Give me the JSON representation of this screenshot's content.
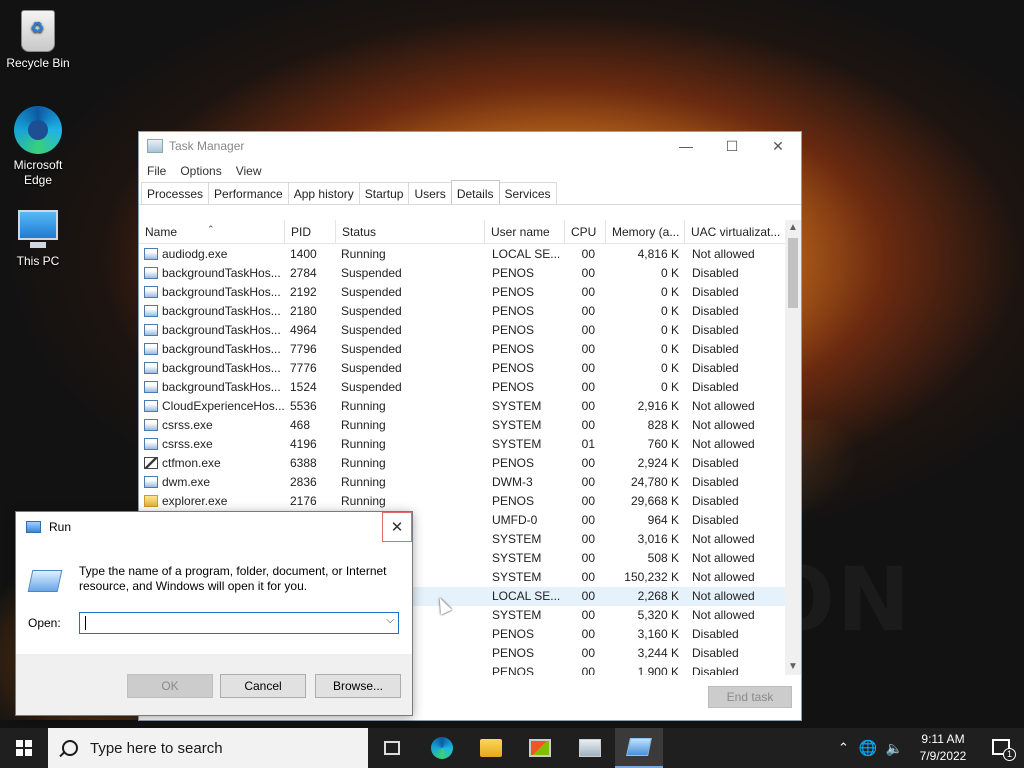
{
  "desktop": {
    "icons": [
      {
        "label": "Recycle Bin"
      },
      {
        "label": "Microsoft Edge"
      },
      {
        "label": "This PC"
      }
    ],
    "wallpaper_text": "ON"
  },
  "task_manager": {
    "title": "Task Manager",
    "menu": [
      "File",
      "Options",
      "View"
    ],
    "tabs": [
      "Processes",
      "Performance",
      "App history",
      "Startup",
      "Users",
      "Details",
      "Services"
    ],
    "active_tab": "Details",
    "columns": [
      "Name",
      "PID",
      "Status",
      "User name",
      "CPU",
      "Memory (a...",
      "UAC virtualizat..."
    ],
    "rows": [
      {
        "icon": "app-icon",
        "name": "audiodg.exe",
        "pid": "1400",
        "status": "Running",
        "user": "LOCAL SE...",
        "cpu": "00",
        "mem": "4,816 K",
        "uac": "Not allowed"
      },
      {
        "icon": "app-icon",
        "name": "backgroundTaskHos...",
        "pid": "2784",
        "status": "Suspended",
        "user": "PENOS",
        "cpu": "00",
        "mem": "0 K",
        "uac": "Disabled"
      },
      {
        "icon": "app-icon",
        "name": "backgroundTaskHos...",
        "pid": "2192",
        "status": "Suspended",
        "user": "PENOS",
        "cpu": "00",
        "mem": "0 K",
        "uac": "Disabled"
      },
      {
        "icon": "app-icon",
        "name": "backgroundTaskHos...",
        "pid": "2180",
        "status": "Suspended",
        "user": "PENOS",
        "cpu": "00",
        "mem": "0 K",
        "uac": "Disabled"
      },
      {
        "icon": "app-icon",
        "name": "backgroundTaskHos...",
        "pid": "4964",
        "status": "Suspended",
        "user": "PENOS",
        "cpu": "00",
        "mem": "0 K",
        "uac": "Disabled"
      },
      {
        "icon": "app-icon",
        "name": "backgroundTaskHos...",
        "pid": "7796",
        "status": "Suspended",
        "user": "PENOS",
        "cpu": "00",
        "mem": "0 K",
        "uac": "Disabled"
      },
      {
        "icon": "app-icon",
        "name": "backgroundTaskHos...",
        "pid": "7776",
        "status": "Suspended",
        "user": "PENOS",
        "cpu": "00",
        "mem": "0 K",
        "uac": "Disabled"
      },
      {
        "icon": "app-icon",
        "name": "backgroundTaskHos...",
        "pid": "1524",
        "status": "Suspended",
        "user": "PENOS",
        "cpu": "00",
        "mem": "0 K",
        "uac": "Disabled"
      },
      {
        "icon": "app-icon",
        "name": "CloudExperienceHos...",
        "pid": "5536",
        "status": "Running",
        "user": "SYSTEM",
        "cpu": "00",
        "mem": "2,916 K",
        "uac": "Not allowed"
      },
      {
        "icon": "app-icon",
        "name": "csrss.exe",
        "pid": "468",
        "status": "Running",
        "user": "SYSTEM",
        "cpu": "00",
        "mem": "828 K",
        "uac": "Not allowed"
      },
      {
        "icon": "app-icon",
        "name": "csrss.exe",
        "pid": "4196",
        "status": "Running",
        "user": "SYSTEM",
        "cpu": "01",
        "mem": "760 K",
        "uac": "Not allowed"
      },
      {
        "icon": "pen-icon",
        "name": "ctfmon.exe",
        "pid": "6388",
        "status": "Running",
        "user": "PENOS",
        "cpu": "00",
        "mem": "2,924 K",
        "uac": "Disabled"
      },
      {
        "icon": "app-icon",
        "name": "dwm.exe",
        "pid": "2836",
        "status": "Running",
        "user": "DWM-3",
        "cpu": "00",
        "mem": "24,780 K",
        "uac": "Disabled"
      },
      {
        "icon": "folder-icon",
        "name": "explorer.exe",
        "pid": "2176",
        "status": "Running",
        "user": "PENOS",
        "cpu": "00",
        "mem": "29,668 K",
        "uac": "Disabled"
      },
      {
        "icon": "",
        "name": "",
        "pid": "",
        "status": "",
        "user": "UMFD-0",
        "cpu": "00",
        "mem": "964 K",
        "uac": "Disabled"
      },
      {
        "icon": "",
        "name": "",
        "pid": "",
        "status": "",
        "user": "SYSTEM",
        "cpu": "00",
        "mem": "3,016 K",
        "uac": "Not allowed"
      },
      {
        "icon": "",
        "name": "",
        "pid": "",
        "status": "",
        "user": "SYSTEM",
        "cpu": "00",
        "mem": "508 K",
        "uac": "Not allowed"
      },
      {
        "icon": "",
        "name": "",
        "pid": "",
        "status": "",
        "user": "SYSTEM",
        "cpu": "00",
        "mem": "150,232 K",
        "uac": "Not allowed"
      },
      {
        "icon": "",
        "name": "",
        "pid": "",
        "status": "",
        "user": "LOCAL SE...",
        "cpu": "00",
        "mem": "2,268 K",
        "uac": "Not allowed",
        "selected": true
      },
      {
        "icon": "",
        "name": "",
        "pid": "",
        "status": "",
        "user": "SYSTEM",
        "cpu": "00",
        "mem": "5,320 K",
        "uac": "Not allowed"
      },
      {
        "icon": "",
        "name": "",
        "pid": "",
        "status": "",
        "user": "PENOS",
        "cpu": "00",
        "mem": "3,160 K",
        "uac": "Disabled"
      },
      {
        "icon": "",
        "name": "",
        "pid": "",
        "status": "",
        "user": "PENOS",
        "cpu": "00",
        "mem": "3,244 K",
        "uac": "Disabled"
      },
      {
        "icon": "",
        "name": "",
        "pid": "",
        "status": "",
        "user": "PENOS",
        "cpu": "00",
        "mem": "1,900 K",
        "uac": "Disabled"
      }
    ],
    "end_task_label": "End task"
  },
  "run_dialog": {
    "title": "Run",
    "message": "Type the name of a program, folder, document, or Internet resource, and Windows will open it for you.",
    "open_label": "Open:",
    "open_value": "",
    "ok_label": "OK",
    "cancel_label": "Cancel",
    "browse_label": "Browse..."
  },
  "taskbar": {
    "search_placeholder": "Type here to search",
    "time": "9:11 AM",
    "date": "7/9/2022",
    "notification_count": "1"
  }
}
